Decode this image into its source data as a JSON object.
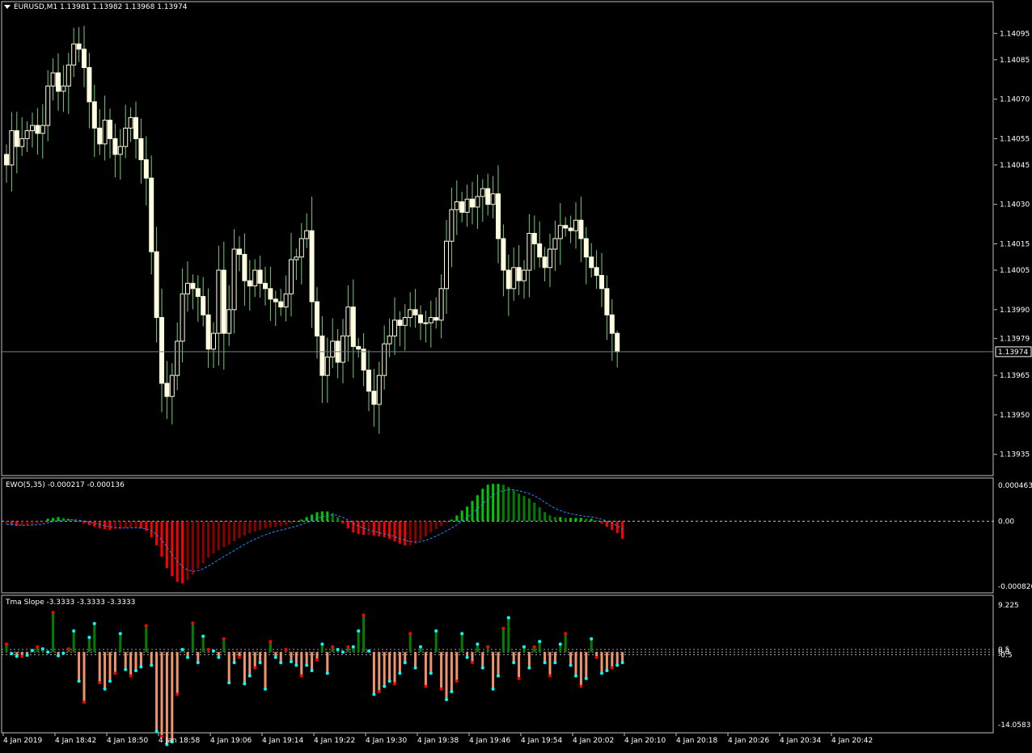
{
  "colors": {
    "background": "#000000",
    "frame": "#c0c0c0",
    "bull_candle": "#ffffe0",
    "bear_candle": "#ffffe0",
    "wick": "#7cc67c",
    "price_line": "#708090",
    "ewo_up": "#00c800",
    "ewo_up_dark": "#008000",
    "ewo_down": "#ff0000",
    "ewo_down_dark": "#8b0000",
    "ewo_signal": "#1e90ff",
    "tma_up": "#008000",
    "tma_down": "#f0946c",
    "dot_cyan": "#00ffff",
    "dot_red": "#ff0000"
  },
  "main_pane": {
    "title": "EURUSD,M1  1.13981 1.13982 1.13968 1.13974",
    "menu_icon": "triangle-down-icon",
    "current_price_label": "1.13974",
    "y_ticks": [
      "1.14095",
      "1.14085",
      "1.14070",
      "1.14055",
      "1.14045",
      "1.14030",
      "1.14015",
      "1.14005",
      "1.13990",
      "1.13979",
      "1.13965",
      "1.13950",
      "1.13935"
    ]
  },
  "ewo_pane": {
    "title": "EWO(5,35) -0.000217 -0.000136",
    "y_ticks": [
      "0.000463",
      "0.00",
      "-0.000826"
    ]
  },
  "tma_pane": {
    "title": "Tma Slope -3.3333 -3.3333 -3.3333",
    "y_ticks": [
      "9.225",
      "0.5",
      "0.0",
      "-0.5",
      "-14.0583"
    ]
  },
  "x_ticks": [
    "4 Jan 2019",
    "4 Jan 18:42",
    "4 Jan 18:50",
    "4 Jan 18:58",
    "4 Jan 19:06",
    "4 Jan 19:14",
    "4 Jan 19:22",
    "4 Jan 19:30",
    "4 Jan 19:38",
    "4 Jan 19:46",
    "4 Jan 19:54",
    "4 Jan 20:02",
    "4 Jan 20:10",
    "4 Jan 20:18",
    "4 Jan 20:26",
    "4 Jan 20:34",
    "4 Jan 20:42"
  ],
  "chart_data": [
    {
      "type": "candlestick",
      "symbol": "EURUSD",
      "timeframe": "M1",
      "last": {
        "open": 1.13981,
        "high": 1.13982,
        "low": 1.13968,
        "close": 1.13974
      },
      "ylim": [
        1.1393,
        1.14104
      ],
      "close": [
        1.14045,
        1.14058,
        1.14052,
        1.14055,
        1.14058,
        1.1406,
        1.14057,
        1.1406,
        1.14075,
        1.1408,
        1.14073,
        1.14075,
        1.14083,
        1.14091,
        1.14089,
        1.14082,
        1.14069,
        1.14059,
        1.14053,
        1.14062,
        1.14055,
        1.14049,
        1.14052,
        1.14059,
        1.14063,
        1.14055,
        1.14047,
        1.1404,
        1.14012,
        1.13987,
        1.13962,
        1.13957,
        1.13965,
        1.13978,
        1.13996,
        1.14,
        1.13998,
        1.13995,
        1.13988,
        1.13975,
        1.13981,
        1.14005,
        1.13981,
        1.1399,
        1.14013,
        1.14011,
        1.14001,
        1.13999,
        1.14005,
        1.14,
        1.13998,
        1.13994,
        1.13993,
        1.13991,
        1.13996,
        1.14009,
        1.1401,
        1.14017,
        1.1402,
        1.13993,
        1.1398,
        1.13965,
        1.13972,
        1.13978,
        1.1397,
        1.1398,
        1.13991,
        1.13976,
        1.13975,
        1.13967,
        1.13959,
        1.13954,
        1.13965,
        1.13977,
        1.1398,
        1.13986,
        1.13984,
        1.13987,
        1.1399,
        1.13988,
        1.13985,
        1.13985,
        1.13987,
        1.13986,
        1.13998,
        1.14016,
        1.14028,
        1.14031,
        1.14027,
        1.14032,
        1.14029,
        1.14033,
        1.14036,
        1.1403,
        1.14034,
        1.14017,
        1.14005,
        1.13998,
        1.14006,
        1.14001,
        1.14005,
        1.14019,
        1.14015,
        1.1401,
        1.14006,
        1.14013,
        1.14017,
        1.14022,
        1.14021,
        1.1402,
        1.14024,
        1.14017,
        1.1401,
        1.14006,
        1.14003,
        1.13998,
        1.13988,
        1.13981,
        1.13974
      ],
      "y_ticks": [
        1.14095,
        1.14085,
        1.1407,
        1.14055,
        1.14045,
        1.1403,
        1.14015,
        1.14005,
        1.1399,
        1.13979,
        1.13965,
        1.1395,
        1.13935
      ],
      "x_ticks": [
        "4 Jan 2019",
        "4 Jan 18:42",
        "4 Jan 18:50",
        "4 Jan 18:58",
        "4 Jan 19:06",
        "4 Jan 19:14",
        "4 Jan 19:22",
        "4 Jan 19:30",
        "4 Jan 19:38",
        "4 Jan 19:46",
        "4 Jan 19:54",
        "4 Jan 20:02",
        "4 Jan 20:10",
        "4 Jan 20:18",
        "4 Jan 20:26",
        "4 Jan 20:34",
        "4 Jan 20:42"
      ]
    },
    {
      "type": "histogram",
      "name": "EWO(5,35)",
      "ylim": [
        -0.000826,
        0.000463
      ],
      "values": [
        -4e-05,
        -5e-05,
        -6e-05,
        -6e-05,
        -5e-05,
        -4e-05,
        -3e-05,
        -2e-05,
        3e-05,
        4e-05,
        5e-05,
        4e-05,
        3e-05,
        1e-05,
        -1e-05,
        -3e-05,
        -5e-05,
        -7e-05,
        -9e-05,
        -0.0001,
        -0.00011,
        -0.0001,
        -0.0001,
        -9e-05,
        -8e-05,
        -8e-05,
        -9e-05,
        -0.00012,
        -0.0002,
        -0.0003,
        -0.00044,
        -0.00058,
        -0.00068,
        -0.00075,
        -0.00077,
        -0.00073,
        -0.00066,
        -0.00059,
        -0.00052,
        -0.00045,
        -0.0004,
        -0.00036,
        -0.00032,
        -0.00029,
        -0.00025,
        -0.00021,
        -0.00018,
        -0.00015,
        -0.00013,
        -0.00011,
        -9e-05,
        -8e-05,
        -7e-05,
        -6e-05,
        -5e-05,
        -3e-05,
        -1e-05,
        2e-05,
        5e-05,
        8e-05,
        0.00011,
        0.00012,
        0.00012,
        0.0001,
        5e-05,
        -3e-05,
        -9e-05,
        -0.00014,
        -0.00016,
        -0.00017,
        -0.00017,
        -0.00018,
        -0.00019,
        -0.0002,
        -0.00022,
        -0.00025,
        -0.00028,
        -0.0003,
        -0.0003,
        -0.00028,
        -0.00024,
        -0.00019,
        -0.00014,
        -0.0001,
        -6e-05,
        -2e-05,
        2e-05,
        7e-05,
        0.00013,
        0.00018,
        0.00025,
        0.00032,
        0.0004,
        0.00045,
        0.00046,
        0.00046,
        0.00045,
        0.00042,
        0.00038,
        0.00034,
        0.00031,
        0.00028,
        0.00023,
        0.00017,
        0.00011,
        7e-05,
        5e-05,
        5e-05,
        4e-05,
        4e-05,
        4e-05,
        4e-05,
        3e-05,
        3e-05,
        1e-05,
        -3e-05,
        -7e-05,
        -0.00011,
        -0.00015,
        -0.00022
      ]
    },
    {
      "type": "histogram",
      "name": "Tma Slope",
      "ylim": [
        -14.0583,
        9.225
      ],
      "values": [
        1.5,
        -0.3,
        -0.8,
        -0.8,
        -0.6,
        0.3,
        1.0,
        0.6,
        0.0,
        7.5,
        -0.7,
        -0.2,
        0.6,
        4.0,
        -5.5,
        -9.5,
        2.8,
        5.4,
        -5.8,
        -7.0,
        -5.5,
        -4.0,
        3.5,
        -3.3,
        -4.5,
        -3.5,
        -2.8,
        5.0,
        -2.5,
        -15.0,
        -16.0,
        -17.5,
        -17.0,
        -8.0,
        0.5,
        -1.0,
        5.5,
        -2.0,
        3.0,
        0.5,
        0.2,
        -1.0,
        2.5,
        -5.8,
        -2.0,
        -1.0,
        -6.0,
        -4.5,
        -3.0,
        -2.0,
        -7.0,
        2.0,
        -1.0,
        -2.0,
        0.5,
        -1.8,
        -2.5,
        -4.5,
        -2.5,
        -3.5,
        -1.5,
        1.5,
        -4.0,
        1.0,
        0.5,
        0.0,
        1.0,
        1.0,
        4.0,
        7.0,
        0.2,
        -8.0,
        -7.5,
        -6.5,
        -5.5,
        -6.0,
        -4.0,
        -2.0,
        3.5,
        -3.0,
        1.0,
        -6.5,
        -4.0,
        4.0,
        -7.0,
        -9.0,
        -7.5,
        -5.5,
        3.5,
        -1.0,
        -2.0,
        1.5,
        -3.0,
        1.0,
        -7.0,
        -4.5,
        4.5,
        6.5,
        -2.0,
        -5.0,
        1.0,
        -3.0,
        1.0,
        2.0,
        -2.0,
        -4.5,
        -2.0,
        1.5,
        3.5,
        -2.5,
        -4.5,
        -6.5,
        -5.0,
        2.5,
        -1.0,
        -4.0,
        -3.5,
        -3.0,
        -2.5,
        -2.0
      ]
    }
  ]
}
